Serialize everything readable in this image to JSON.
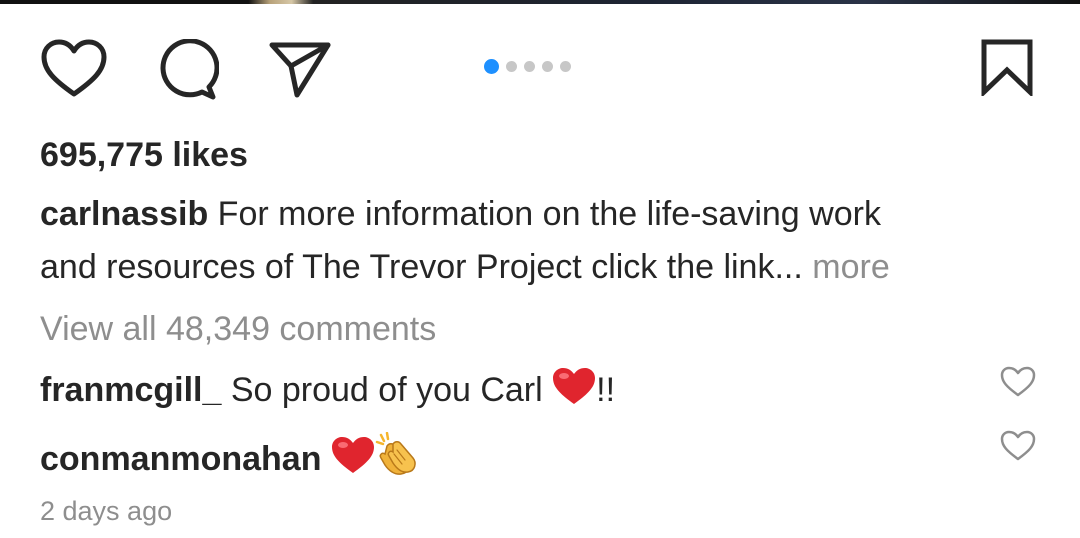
{
  "post": {
    "likes_label": "695,775 likes",
    "caption": {
      "username": "carlnassib",
      "line1_text": "For more information on the life-saving work",
      "line2_text": "and resources of The Trevor Project click the link",
      "ellipsis": "...",
      "more_label": "more"
    },
    "view_all_comments_label": "View all 48,349 comments",
    "comments": [
      {
        "username": "franmcgill_",
        "text": "So proud of you Carl",
        "suffix": "!!"
      },
      {
        "username": "conmanmonahan",
        "text": ""
      }
    ],
    "timestamp": "2 days ago"
  },
  "carousel": {
    "count": 5,
    "active_index": 0
  },
  "icons": {
    "like": "heart-outline-icon",
    "comment": "speech-bubble-icon",
    "share": "paper-plane-icon",
    "save": "bookmark-icon",
    "comment_like": "heart-outline-icon",
    "emoji_heart": "red-heart-emoji",
    "emoji_clap": "clapping-hands-emoji"
  },
  "colors": {
    "text": "#262626",
    "muted": "#8e8e8e",
    "accent_blue": "#1e90ff",
    "dot_inactive": "#c7c7c7",
    "heart_red": "#e0252e",
    "clap_yellow": "#f5b52c"
  }
}
